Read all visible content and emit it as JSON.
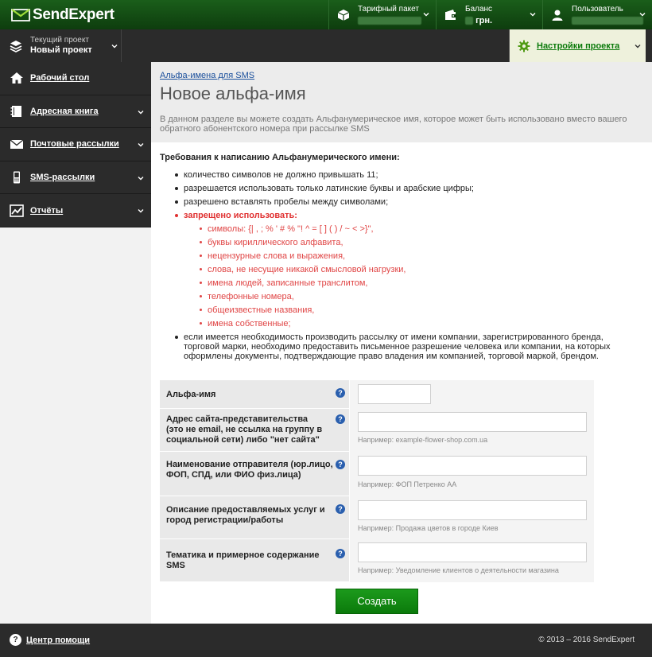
{
  "brand": {
    "name_a": "Send",
    "name_b": "Expert"
  },
  "topbar": {
    "tariff_label": "Тарифный пакет",
    "balance_label": "Баланс",
    "balance_currency": "грн.",
    "user_label": "Пользователь"
  },
  "project": {
    "label": "Текущий проект",
    "name": "Новый проект"
  },
  "settings": {
    "label": "Настройки проекта"
  },
  "sidebar": {
    "items": [
      {
        "label": "Рабочий стол",
        "icon": "home-icon"
      },
      {
        "label": "Адресная книга",
        "icon": "book-icon"
      },
      {
        "label": "Почтовые рассылки",
        "icon": "mail-icon"
      },
      {
        "label": "SMS-рассылки",
        "icon": "phone-icon"
      },
      {
        "label": "Отчёты",
        "icon": "chart-icon"
      }
    ]
  },
  "page": {
    "breadcrumb": "Альфа-имена для SMS",
    "title": "Новое альфа-имя",
    "description": "В данном разделе вы можете создать Альфанумерическое имя, которое может быть использовано вместо вашего обратного абонентского номера при рассылке SMS"
  },
  "requirements": {
    "title": "Требования к написанию Альфанумерического имени:",
    "items": [
      "количество символов не должно привышать 11;",
      "разрешается использовать только латинские буквы и арабские цифры;",
      "разрешено вставлять пробелы между символами;"
    ],
    "forbidden_title": "запрещено использовать:",
    "forbidden": [
      "символы: {| , ; % ' # % \"! ^ = [ ] ( ) / ~ < >}\",",
      "буквы кириллического алфавита,",
      "нецензурные слова и выражения,",
      "слова, не несущие никакой смысловой нагрузки,",
      "имена людей, записанные транслитом,",
      "телефонные номера,",
      "общеизвестные названия,",
      "имена собственные;"
    ],
    "company_note": "если имеется необходимость производить рассылку от имени компании, зарегистрированного бренда, торговой марки, необходимо предоставить письменное разрешение человека или компании, на которых оформлены документы, подтверждающие право владения им компанией, торговой маркой, брендом."
  },
  "form": {
    "alpha_label": "Альфа-имя",
    "site_label": "Адрес сайта-представительства (это не email, не ссылка на группу в социальной сети) либо \"нет сайта\"",
    "site_hint": "Например: example-flower-shop.com.ua",
    "sender_label": "Наименование отправителя (юр.лицо, ФОП, СПД, или ФИО физ.лица)",
    "sender_hint": "Например: ФОП Петренко АА",
    "services_label": "Описание предоставляемых услуг и город регистрации/работы",
    "services_hint": "Например: Продажа цветов в городе Киев",
    "topic_label": "Тематика и примерное содержание SMS",
    "topic_hint": "Например: Уведомление клиентов о деятельности магазина",
    "help_glyph": "?",
    "submit_label": "Создать"
  },
  "footer": {
    "help_label": "Центр помощи",
    "help_glyph": "?",
    "copyright": "© 2013 – 2016 SendExpert"
  },
  "colors": {
    "brand_green": "#0b7a0b",
    "dark": "#2b2b2b",
    "forbidden_red": "#e03030",
    "link_blue": "#1a4f9c"
  }
}
